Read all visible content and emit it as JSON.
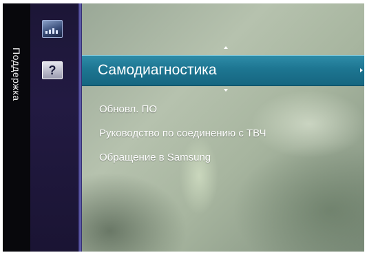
{
  "sidebar": {
    "section_label": "Поддержка",
    "icons": [
      {
        "name": "picture-icon"
      },
      {
        "name": "support-icon",
        "glyph": "?"
      }
    ]
  },
  "menu": {
    "selected": "Самодиагностика",
    "items": [
      "Обновл. ПО",
      "Руководство по соединению с ТВЧ",
      "Обращение в Samsung"
    ]
  },
  "colors": {
    "highlight": "#1d7591",
    "icon_bar": "#1c1636",
    "separator": "#6b6ab8"
  }
}
